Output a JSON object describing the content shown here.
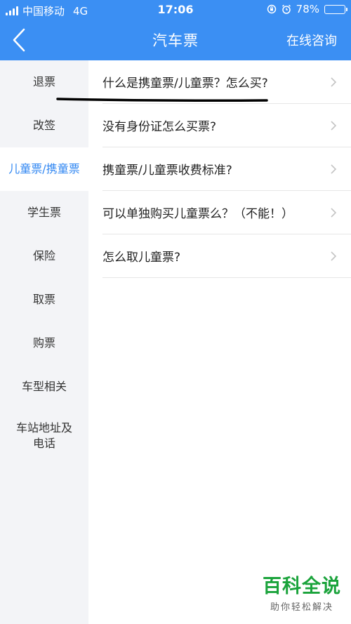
{
  "status_bar": {
    "carrier": "中国移动",
    "network": "4G",
    "time": "17:06",
    "battery": "78%",
    "battery_level": 0.78
  },
  "nav": {
    "title": "汽车票",
    "action": "在线咨询"
  },
  "sidebar": {
    "items": [
      {
        "label": "退票"
      },
      {
        "label": "改签"
      },
      {
        "label": "儿童票/携童票"
      },
      {
        "label": "学生票"
      },
      {
        "label": "保险"
      },
      {
        "label": "取票"
      },
      {
        "label": "购票"
      },
      {
        "label": "车型相关"
      },
      {
        "label": "车站地址及电话"
      }
    ],
    "active_index": 2
  },
  "questions": [
    {
      "text": "什么是携童票/儿童票？怎么买?"
    },
    {
      "text": "没有身份证怎么买票?"
    },
    {
      "text": "携童票/儿童票收费标准?"
    },
    {
      "text": "可以单独购买儿童票么？（不能！）"
    },
    {
      "text": "怎么取儿童票?"
    }
  ],
  "watermark": {
    "main": "百科全说",
    "sub": "助你轻松解决"
  },
  "colors": {
    "header": "#3b8ff3",
    "active": "#2f86f2",
    "sidebar_bg": "#f3f4f7",
    "watermark": "#1aa33b"
  }
}
